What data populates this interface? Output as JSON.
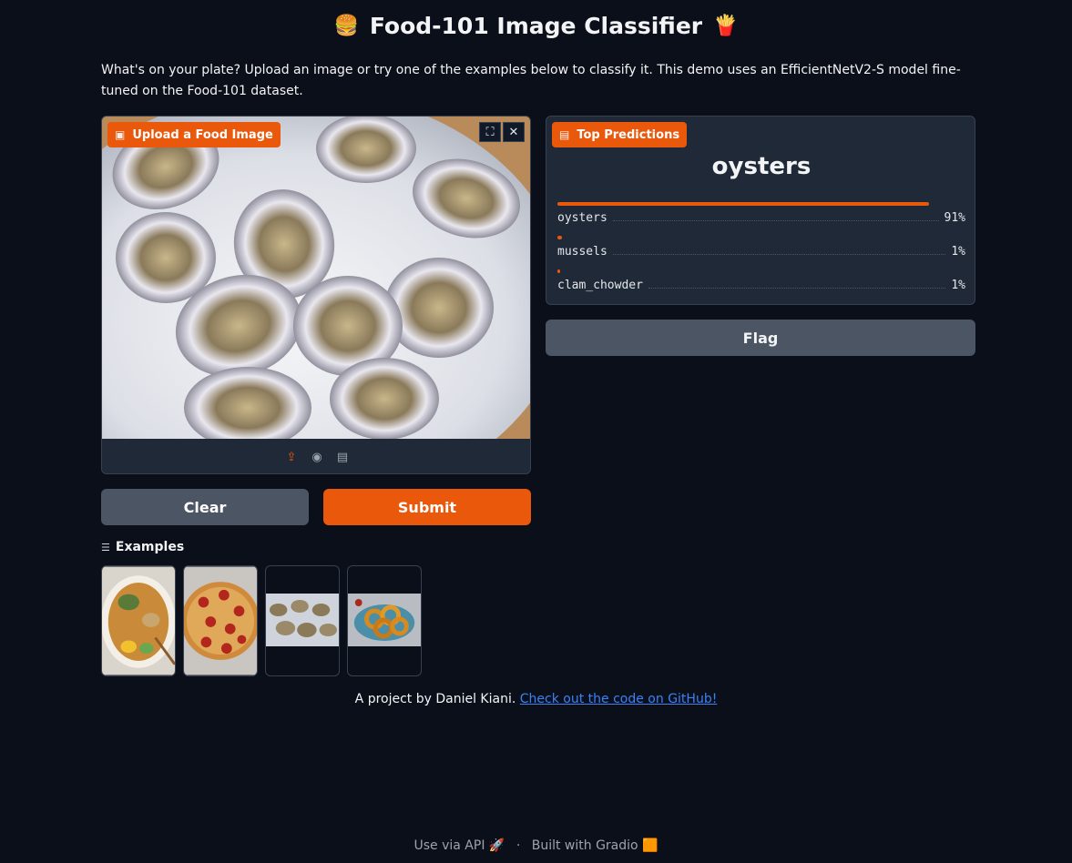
{
  "header": {
    "emoji_left": "🍔",
    "title": "Food-101 Image Classifier",
    "emoji_right": "🍟",
    "description": "What's on your plate? Upload an image or try one of the examples below to classify it. This demo uses an EfficientNetV2-S model fine-tuned on the Food-101 dataset."
  },
  "upload": {
    "label": "Upload a Food Image",
    "label_icon": "image-icon",
    "tools": {
      "fullscreen_icon": "fullscreen-icon",
      "close_icon": "close-icon"
    },
    "sources": [
      "upload-icon",
      "webcam-icon",
      "clipboard-icon"
    ]
  },
  "buttons": {
    "clear": "Clear",
    "submit": "Submit",
    "flag": "Flag"
  },
  "examples": {
    "label": "Examples",
    "items": [
      "ramen",
      "pizza",
      "oysters",
      "onion_rings"
    ]
  },
  "predictions": {
    "label": "Top Predictions",
    "top_label": "oysters",
    "items": [
      {
        "name": "oysters",
        "pct": "91%",
        "value": 0.91
      },
      {
        "name": "mussels",
        "pct": "1%",
        "value": 0.012
      },
      {
        "name": "clam_chowder",
        "pct": "1%",
        "value": 0.005
      }
    ]
  },
  "credit": {
    "text": "A project by Daniel Kiani.",
    "link": "Check out the code on GitHub!"
  },
  "footer": {
    "api": "Use via API",
    "sep": "·",
    "built": "Built with Gradio"
  },
  "colors": {
    "accent": "#ea580c",
    "bg": "#0b0f19",
    "panel": "#1f2937",
    "link": "#3b82f6"
  }
}
